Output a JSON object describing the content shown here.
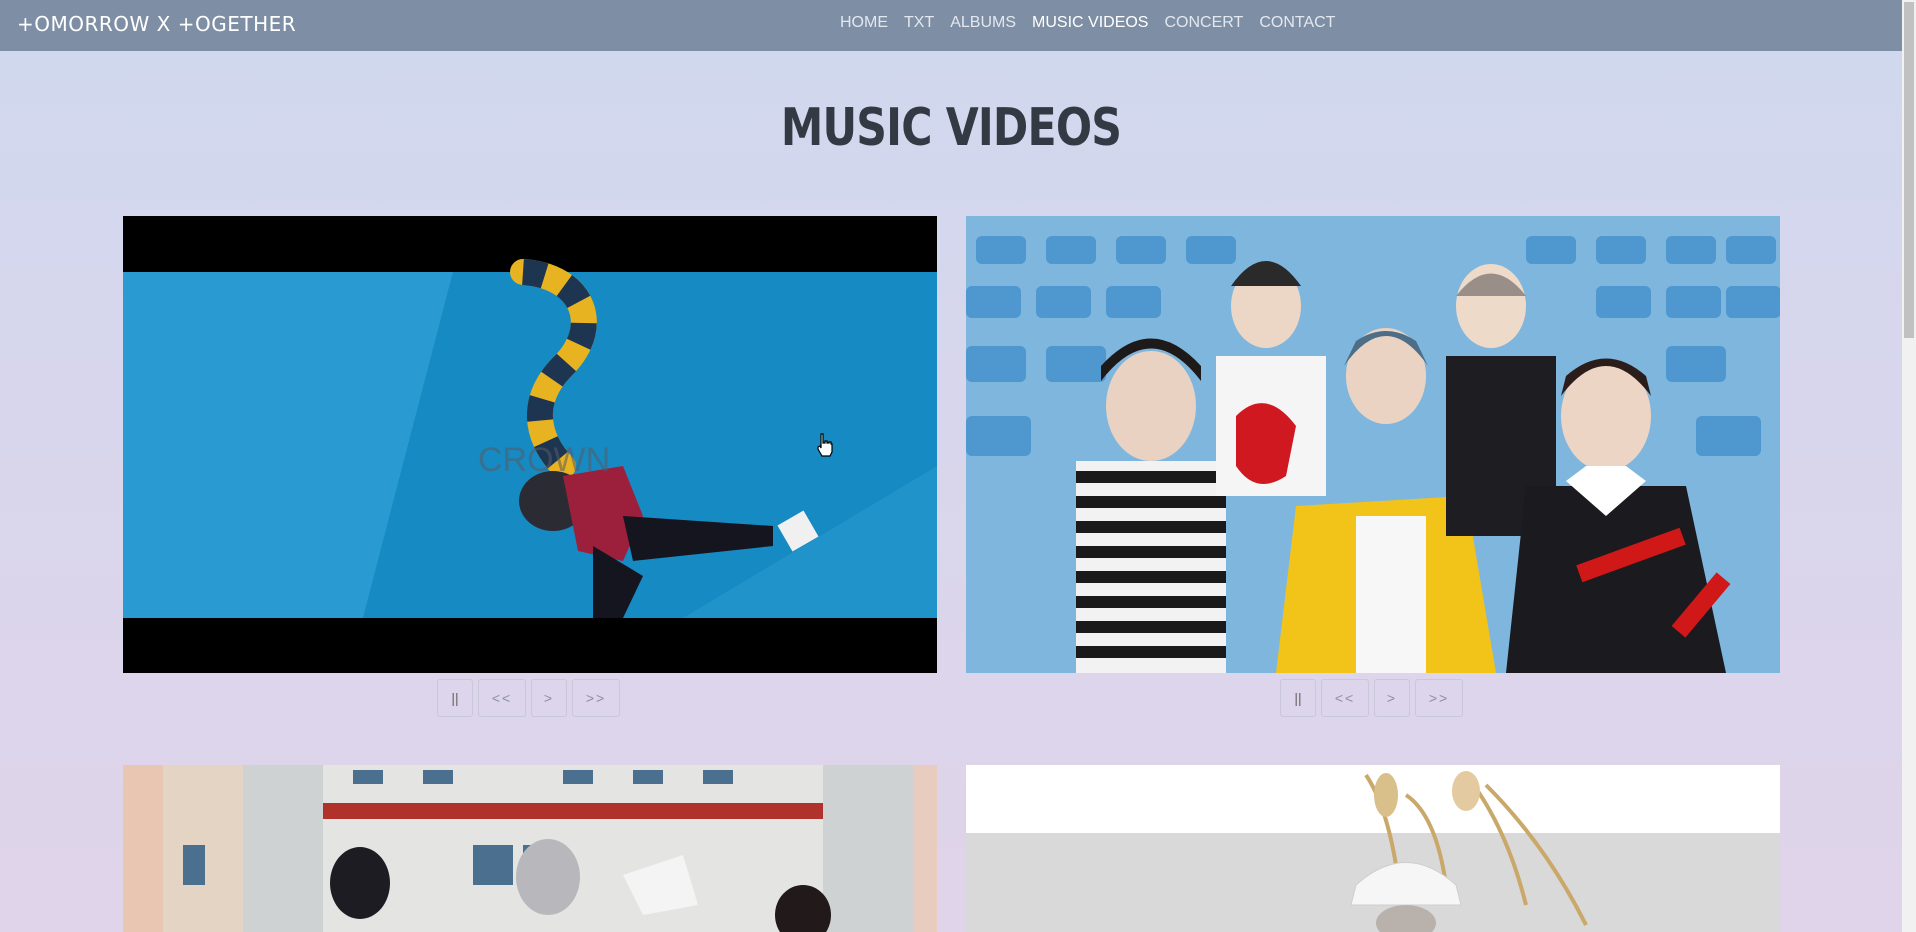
{
  "navbar": {
    "brand": "+OMORROW X +OGETHER",
    "links": [
      "HOME",
      "TXT",
      "ALBUMS",
      "MUSIC VIDEOS",
      "CONCERT",
      "CONTACT"
    ],
    "active": "MUSIC VIDEOS"
  },
  "page": {
    "title": "MUSIC VIDEOS"
  },
  "videos": [
    {
      "overlay_text": "CROWN"
    },
    {
      "overlay_text": ""
    },
    {
      "overlay_text": ""
    },
    {
      "overlay_text": ""
    }
  ],
  "controls": {
    "pause": "||",
    "prev": "<<",
    "play": ">",
    "next": ">>"
  },
  "colors": {
    "navbar": "#7e8ea4",
    "title": "#333a44",
    "bg_top": "#cfd8ee",
    "bg_bottom": "#e0d4ea"
  }
}
